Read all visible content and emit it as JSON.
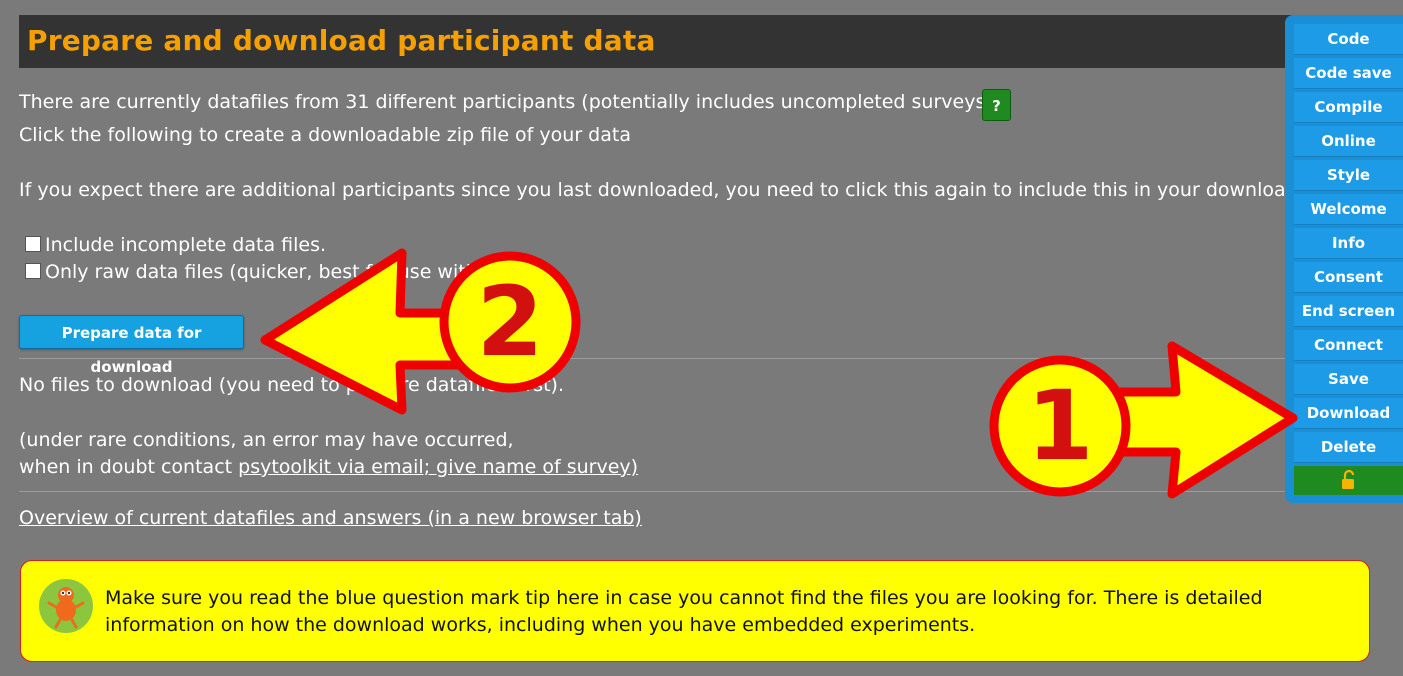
{
  "header": {
    "title": "Prepare and download participant data"
  },
  "intro": {
    "line1": "There are currently datafiles from 31 different participants (potentially includes uncompleted surveys).",
    "help_label": "?",
    "line2": "Click the following to create a downloadable zip file of your data",
    "line3": "If you expect there are additional participants since you last downloaded, you need to click this again to include this in your download."
  },
  "options": [
    {
      "label": "Include incomplete data files.",
      "checked": false
    },
    {
      "label": "Only raw data files (quicker, best for use with",
      "checked": false
    }
  ],
  "prepare_button": "Prepare data for download",
  "status": {
    "no_files_text": "No files to download (you need to prepare datafiles first).",
    "rare_error_line": "(under rare conditions, an error may have occurred,",
    "contact_prefix": "when in doubt contact ",
    "contact_link": "psytoolkit via email; give name of survey)"
  },
  "overview_link": "Overview of current datafiles and answers (in a new browser tab)",
  "tip": {
    "text": "Make sure you read the blue question mark tip here in case you cannot find the files you are looking for. There is detailed information on how the download works, including when you have embedded experiments."
  },
  "sidebar": {
    "items": [
      {
        "label": "Code"
      },
      {
        "label": "Code save"
      },
      {
        "label": "Compile"
      },
      {
        "label": "Online"
      },
      {
        "label": "Style"
      },
      {
        "label": "Welcome"
      },
      {
        "label": "Info"
      },
      {
        "label": "Consent"
      },
      {
        "label": "End screen"
      },
      {
        "label": "Connect"
      },
      {
        "label": "Save"
      },
      {
        "label": "Download"
      },
      {
        "label": "Delete"
      }
    ],
    "lock_icon": "unlock-icon"
  },
  "annotations": [
    {
      "label": "1",
      "points_to": "Download"
    },
    {
      "label": "2",
      "points_to": "Prepare data for download"
    }
  ],
  "colors": {
    "background": "#7a7a7a",
    "title_bg": "#333333",
    "title_text": "#f5a000",
    "sidebar": "#1d9be6",
    "help_button": "#1f8a1f",
    "tip_bg": "#ffff00",
    "arrow_fill": "#ffff00",
    "arrow_stroke": "#ee0000"
  }
}
